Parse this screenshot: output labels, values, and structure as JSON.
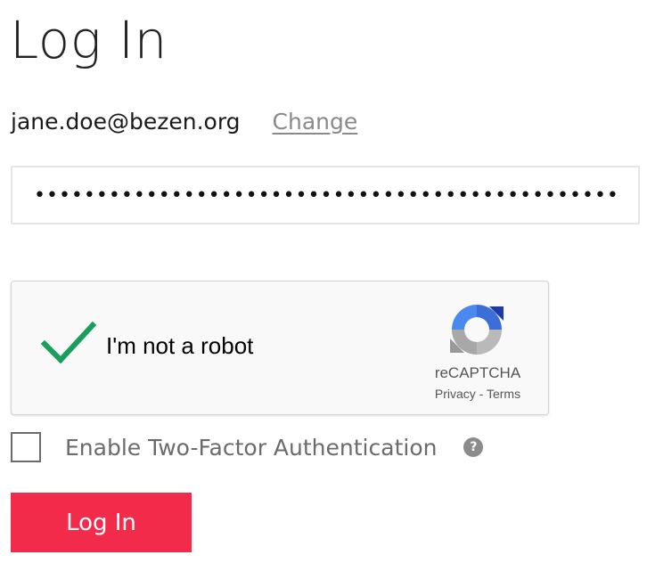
{
  "page": {
    "title": "Log In"
  },
  "account": {
    "email": "jane.doe@bezen.org",
    "change_label": "Change"
  },
  "password": {
    "value": "••••••••••••••••••••••••••••••••••••••••••••••••••"
  },
  "recaptcha": {
    "label": "I'm not a robot",
    "checked": true,
    "brand": "reCAPTCHA",
    "privacy_label": "Privacy",
    "separator": " - ",
    "terms_label": "Terms",
    "icons": [
      "checkmark-icon",
      "recaptcha-logo-icon"
    ]
  },
  "two_factor": {
    "label": "Enable Two-Factor Authentication",
    "checked": false,
    "help_glyph": "?"
  },
  "login_button": {
    "label": "Log In"
  },
  "colors": {
    "primary_button": "#f22b4b",
    "check_green": "#1a9e5c",
    "link_gray": "#8a8a8a"
  }
}
